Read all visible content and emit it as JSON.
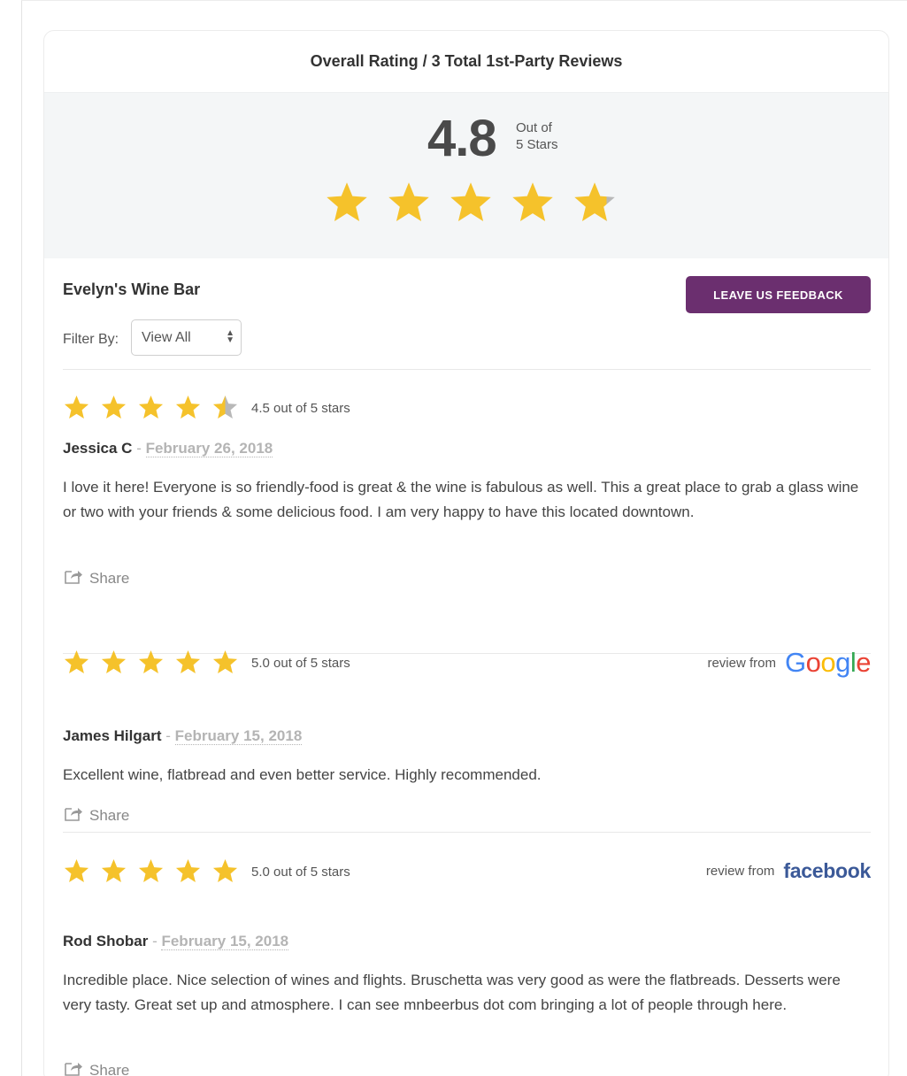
{
  "header": {
    "title": "Overall Rating / 3 Total 1st-Party Reviews"
  },
  "summary": {
    "score": "4.8",
    "out_of_line1": "Out of",
    "out_of_line2": "5 Stars",
    "stars": 4.8
  },
  "business": {
    "name": "Evelyn's Wine Bar",
    "feedback_button": "LEAVE US FEEDBACK",
    "filter_label": "Filter By:",
    "filter_value": "View All"
  },
  "colors": {
    "star_gold": "#f5c22b",
    "star_gray": "#b8b8b8",
    "button_purple": "#6b2f6f",
    "facebook_blue": "#3b5998"
  },
  "reviews": [
    {
      "stars": 4.5,
      "rating_text": "4.5 out of 5 stars",
      "author": "Jessica C",
      "date": "February 26, 2018",
      "body": "I love it here! Everyone is so friendly-food is great & the wine is fabulous as well. This a great place to grab a glass wine or two with your friends & some delicious food. I am very happy to have this located downtown.",
      "share_label": "Share"
    },
    {
      "stars": 5,
      "rating_text": "5.0 out of 5 stars",
      "author": "James Hilgart",
      "date": "February 15, 2018",
      "body": "Excellent wine, flatbread and even better service. Highly recommended.",
      "share_label": "Share",
      "source_label": "review from",
      "source": "Google"
    },
    {
      "stars": 5,
      "rating_text": "5.0 out of 5 stars",
      "author": "Rod Shobar",
      "date": "February 15, 2018",
      "body": "Incredible place. Nice selection of wines and flights. Bruschetta was very good as were the flatbreads. Desserts were very tasty. Great set up and atmosphere. I can see mnbeerbus dot com bringing a lot of people through here.",
      "share_label": "Share",
      "source_label": "review from",
      "source": "facebook"
    }
  ],
  "icons": {
    "star": "star-icon",
    "share": "share-icon",
    "select_arrows": "select-arrows-icon"
  }
}
